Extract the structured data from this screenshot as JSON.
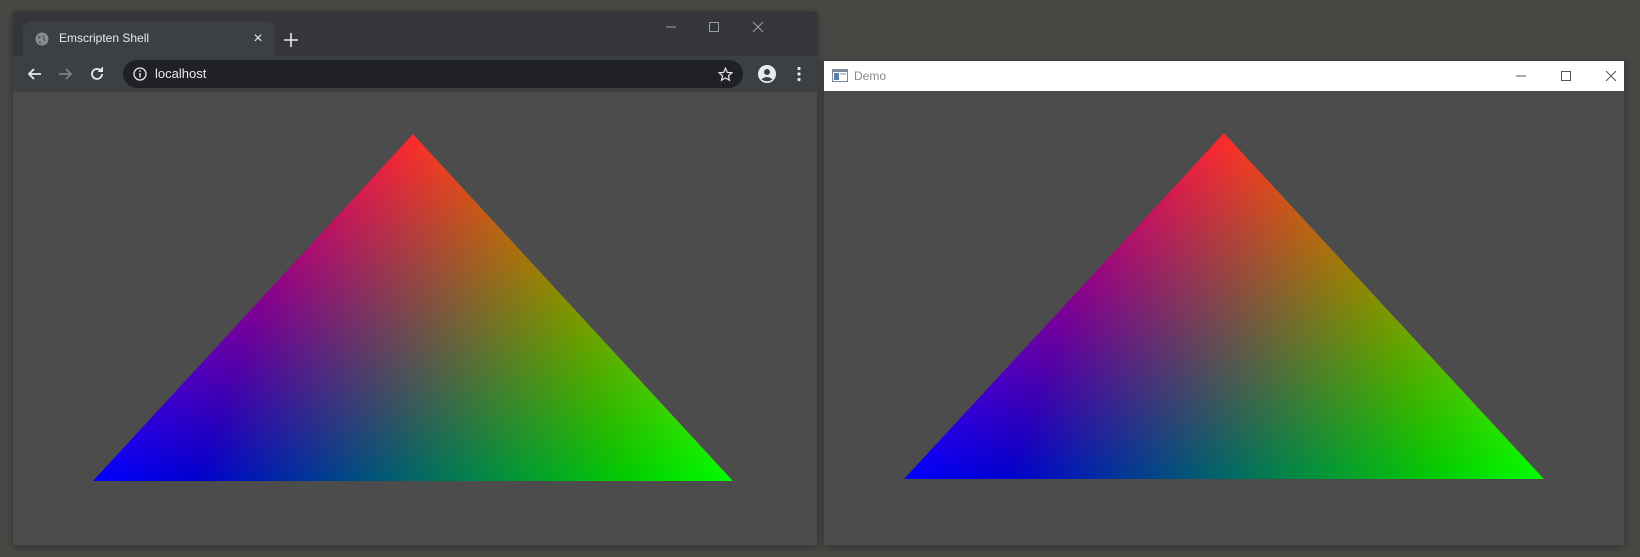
{
  "browser": {
    "tab_title": "Emscripten Shell",
    "tab_close_glyph": "×",
    "url": "localhost",
    "icons": {
      "favicon": "globe-icon",
      "new_tab": "plus-icon",
      "back": "arrow-left-icon",
      "forward": "arrow-right-icon",
      "reload": "reload-icon",
      "info": "info-icon",
      "bookmark": "star-icon",
      "profile": "account-icon",
      "menu": "kebab-menu-icon",
      "minimize": "minimize-icon",
      "maximize": "maximize-icon",
      "close": "close-icon"
    }
  },
  "native_window": {
    "title": "Demo",
    "icons": {
      "app": "window-app-icon",
      "minimize": "minimize-icon",
      "maximize": "maximize-icon",
      "close": "close-icon"
    }
  },
  "triangle": {
    "vertex_colors": {
      "top": "#ff0000",
      "bottom_left": "#0000ff",
      "bottom_right": "#00ff00"
    }
  },
  "colors": {
    "desktop": "#4a4845",
    "canvas_background": "#4c4c4c",
    "browser_titlebar": "#35363a",
    "browser_toolbar": "#3c4043",
    "omnibox": "#202124",
    "native_titlebar": "#ffffff"
  }
}
